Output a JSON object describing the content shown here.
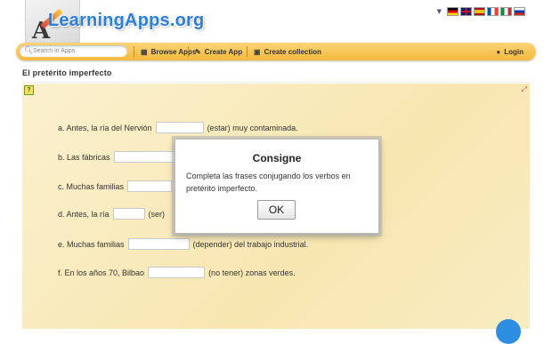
{
  "header": {
    "logo_text": "LearningApps.org",
    "languages": [
      {
        "code": "de",
        "icon": "flag-germany-icon"
      },
      {
        "code": "gb",
        "icon": "flag-uk-icon"
      },
      {
        "code": "es",
        "icon": "flag-spain-icon"
      },
      {
        "code": "fr",
        "icon": "flag-france-icon"
      },
      {
        "code": "it",
        "icon": "flag-italy-icon"
      },
      {
        "code": "ru",
        "icon": "flag-russia-icon"
      }
    ]
  },
  "navbar": {
    "search_placeholder": "Search in Apps",
    "browse_label": "Browse Apps",
    "create_label": "Create App",
    "collection_label": "Create collection",
    "login_label": "Login",
    "accent": "#f3b93d"
  },
  "page": {
    "title": "El pretérito imperfecto"
  },
  "exercise": {
    "lines": [
      {
        "before": "a. Antes, la ría del Nervión",
        "after": "(estar) muy contaminada."
      },
      {
        "before": "b. Las fábricas",
        "after": ""
      },
      {
        "before": "c. Muchas familias",
        "after": ""
      },
      {
        "before": "d. Antes, la ría",
        "after": "(ser)"
      },
      {
        "before": "e. Muchas familias",
        "after": "(depender) del trabajo industrial."
      },
      {
        "before": "f. En los años 70, Bilbao",
        "after": "(no tener) zonas verdes."
      }
    ]
  },
  "dialog": {
    "title": "Consigne",
    "body": "Completa las frases conjugando los verbos en pretérito imperfecto.",
    "ok_label": "OK"
  }
}
